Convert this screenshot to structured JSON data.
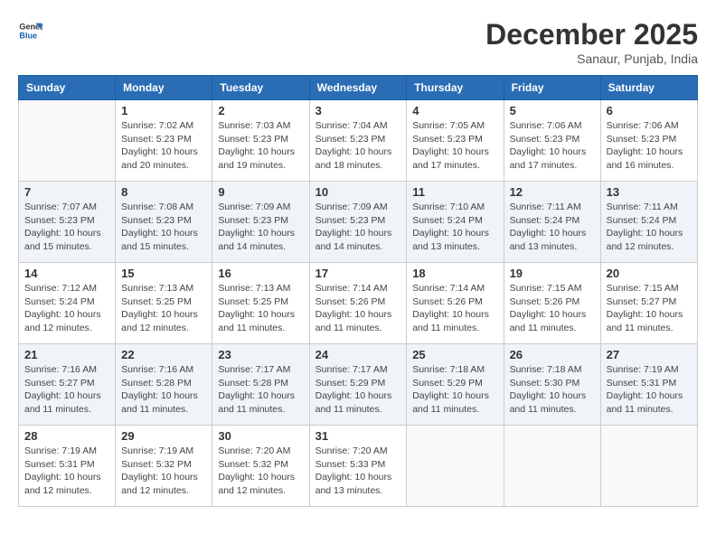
{
  "header": {
    "logo_general": "General",
    "logo_blue": "Blue",
    "month": "December 2025",
    "location": "Sanaur, Punjab, India"
  },
  "days_of_week": [
    "Sunday",
    "Monday",
    "Tuesday",
    "Wednesday",
    "Thursday",
    "Friday",
    "Saturday"
  ],
  "weeks": [
    [
      {
        "day": "",
        "info": ""
      },
      {
        "day": "1",
        "info": "Sunrise: 7:02 AM\nSunset: 5:23 PM\nDaylight: 10 hours\nand 20 minutes."
      },
      {
        "day": "2",
        "info": "Sunrise: 7:03 AM\nSunset: 5:23 PM\nDaylight: 10 hours\nand 19 minutes."
      },
      {
        "day": "3",
        "info": "Sunrise: 7:04 AM\nSunset: 5:23 PM\nDaylight: 10 hours\nand 18 minutes."
      },
      {
        "day": "4",
        "info": "Sunrise: 7:05 AM\nSunset: 5:23 PM\nDaylight: 10 hours\nand 17 minutes."
      },
      {
        "day": "5",
        "info": "Sunrise: 7:06 AM\nSunset: 5:23 PM\nDaylight: 10 hours\nand 17 minutes."
      },
      {
        "day": "6",
        "info": "Sunrise: 7:06 AM\nSunset: 5:23 PM\nDaylight: 10 hours\nand 16 minutes."
      }
    ],
    [
      {
        "day": "7",
        "info": "Sunrise: 7:07 AM\nSunset: 5:23 PM\nDaylight: 10 hours\nand 15 minutes."
      },
      {
        "day": "8",
        "info": "Sunrise: 7:08 AM\nSunset: 5:23 PM\nDaylight: 10 hours\nand 15 minutes."
      },
      {
        "day": "9",
        "info": "Sunrise: 7:09 AM\nSunset: 5:23 PM\nDaylight: 10 hours\nand 14 minutes."
      },
      {
        "day": "10",
        "info": "Sunrise: 7:09 AM\nSunset: 5:23 PM\nDaylight: 10 hours\nand 14 minutes."
      },
      {
        "day": "11",
        "info": "Sunrise: 7:10 AM\nSunset: 5:24 PM\nDaylight: 10 hours\nand 13 minutes."
      },
      {
        "day": "12",
        "info": "Sunrise: 7:11 AM\nSunset: 5:24 PM\nDaylight: 10 hours\nand 13 minutes."
      },
      {
        "day": "13",
        "info": "Sunrise: 7:11 AM\nSunset: 5:24 PM\nDaylight: 10 hours\nand 12 minutes."
      }
    ],
    [
      {
        "day": "14",
        "info": "Sunrise: 7:12 AM\nSunset: 5:24 PM\nDaylight: 10 hours\nand 12 minutes."
      },
      {
        "day": "15",
        "info": "Sunrise: 7:13 AM\nSunset: 5:25 PM\nDaylight: 10 hours\nand 12 minutes."
      },
      {
        "day": "16",
        "info": "Sunrise: 7:13 AM\nSunset: 5:25 PM\nDaylight: 10 hours\nand 11 minutes."
      },
      {
        "day": "17",
        "info": "Sunrise: 7:14 AM\nSunset: 5:26 PM\nDaylight: 10 hours\nand 11 minutes."
      },
      {
        "day": "18",
        "info": "Sunrise: 7:14 AM\nSunset: 5:26 PM\nDaylight: 10 hours\nand 11 minutes."
      },
      {
        "day": "19",
        "info": "Sunrise: 7:15 AM\nSunset: 5:26 PM\nDaylight: 10 hours\nand 11 minutes."
      },
      {
        "day": "20",
        "info": "Sunrise: 7:15 AM\nSunset: 5:27 PM\nDaylight: 10 hours\nand 11 minutes."
      }
    ],
    [
      {
        "day": "21",
        "info": "Sunrise: 7:16 AM\nSunset: 5:27 PM\nDaylight: 10 hours\nand 11 minutes."
      },
      {
        "day": "22",
        "info": "Sunrise: 7:16 AM\nSunset: 5:28 PM\nDaylight: 10 hours\nand 11 minutes."
      },
      {
        "day": "23",
        "info": "Sunrise: 7:17 AM\nSunset: 5:28 PM\nDaylight: 10 hours\nand 11 minutes."
      },
      {
        "day": "24",
        "info": "Sunrise: 7:17 AM\nSunset: 5:29 PM\nDaylight: 10 hours\nand 11 minutes."
      },
      {
        "day": "25",
        "info": "Sunrise: 7:18 AM\nSunset: 5:29 PM\nDaylight: 10 hours\nand 11 minutes."
      },
      {
        "day": "26",
        "info": "Sunrise: 7:18 AM\nSunset: 5:30 PM\nDaylight: 10 hours\nand 11 minutes."
      },
      {
        "day": "27",
        "info": "Sunrise: 7:19 AM\nSunset: 5:31 PM\nDaylight: 10 hours\nand 11 minutes."
      }
    ],
    [
      {
        "day": "28",
        "info": "Sunrise: 7:19 AM\nSunset: 5:31 PM\nDaylight: 10 hours\nand 12 minutes."
      },
      {
        "day": "29",
        "info": "Sunrise: 7:19 AM\nSunset: 5:32 PM\nDaylight: 10 hours\nand 12 minutes."
      },
      {
        "day": "30",
        "info": "Sunrise: 7:20 AM\nSunset: 5:32 PM\nDaylight: 10 hours\nand 12 minutes."
      },
      {
        "day": "31",
        "info": "Sunrise: 7:20 AM\nSunset: 5:33 PM\nDaylight: 10 hours\nand 13 minutes."
      },
      {
        "day": "",
        "info": ""
      },
      {
        "day": "",
        "info": ""
      },
      {
        "day": "",
        "info": ""
      }
    ]
  ]
}
